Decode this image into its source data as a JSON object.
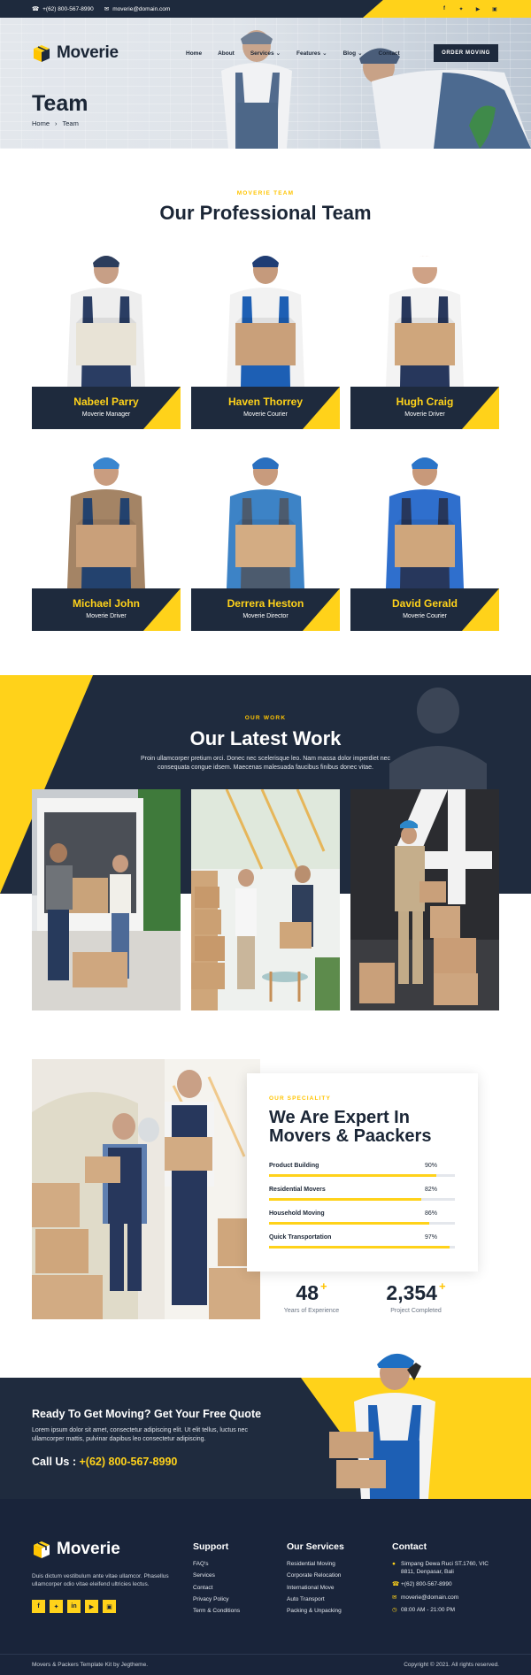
{
  "topbar": {
    "phone": "+(62) 800-567-8990",
    "email": "moverie@domain.com",
    "social": [
      "f",
      "t",
      "yt",
      "ig"
    ]
  },
  "brand": {
    "name": "Moverie"
  },
  "nav": {
    "items": [
      "Home",
      "About",
      "Services",
      "Features",
      "Blog",
      "Contact"
    ],
    "order_button": "ORDER MOVING"
  },
  "hero": {
    "title": "Team",
    "breadcrumb_home": "Home",
    "breadcrumb_current": "Team"
  },
  "team": {
    "eyebrow": "MOVERIE TEAM",
    "title": "Our Professional Team",
    "members": [
      {
        "name": "Nabeel Parry",
        "role": "Moverie Manager"
      },
      {
        "name": "Haven Thorrey",
        "role": "Moverie Courier"
      },
      {
        "name": "Hugh Craig",
        "role": "Moverie Driver"
      },
      {
        "name": "Michael John",
        "role": "Moverie Driver"
      },
      {
        "name": "Derrera Heston",
        "role": "Moverie Director"
      },
      {
        "name": "David Gerald",
        "role": "Moverie Courier"
      }
    ]
  },
  "work": {
    "eyebrow": "OUR WORK",
    "title": "Our Latest Work",
    "text": "Proin ullamcorper pretium orci. Donec nec scelerisque leo. Nam massa dolor imperdiet nec consequata congue idsem. Maecenas malesuada faucibus finibus donec vitae."
  },
  "speciality": {
    "eyebrow": "OUR SPECIALITY",
    "title": "We Are Expert In Movers & Paackers",
    "skills": [
      {
        "label": "Product Building",
        "percent_text": "90%",
        "value": 0.9
      },
      {
        "label": "Residential Movers",
        "percent_text": "82%",
        "value": 0.82
      },
      {
        "label": "Household Moving",
        "percent_text": "86%",
        "value": 0.86
      },
      {
        "label": "Quick Transportation",
        "percent_text": "97%",
        "value": 0.97
      }
    ],
    "stats": [
      {
        "number": "48",
        "plus": "+",
        "caption": "Years of Experience"
      },
      {
        "number": "2,354",
        "plus": "+",
        "caption": "Project Completed"
      }
    ]
  },
  "cta": {
    "title": "Ready To Get Moving? Get Your Free Quote",
    "text": "Lorem ipsum dolor sit amet, consectetur adipiscing elit. Ut elit tellus, luctus nec ullamcorper mattis, pulvinar dapibus leo consectetur adipiscing.",
    "call_label": "Call Us : ",
    "call_phone": "+(62) 800-567-8990"
  },
  "footer": {
    "about": "Duis dictum vestibulum ante vitae ullamcor. Phasellus ullamcorper odio vitae eleifend ultricies lectus.",
    "social": [
      "f",
      "t",
      "in",
      "yt",
      "ig"
    ],
    "support": {
      "title": "Support",
      "items": [
        "FAQ's",
        "Services",
        "Contact",
        "Privacy Policy",
        "Term & Conditions"
      ]
    },
    "services": {
      "title": "Our Services",
      "items": [
        "Residential Moving",
        "Corporate Relocation",
        "International Move",
        "Auto Transport",
        "Packing & Unpacking"
      ]
    },
    "contact": {
      "title": "Contact",
      "address": "Simpang Dewa Ruci ST.1760, VIC 8811, Denpasar, Bali",
      "phone": "+(62) 800-567-8990",
      "email": "moverie@domain.com",
      "hours": "08:00 AM - 21:00 PM"
    },
    "bottom_left": "Movers & Packers Template Kit by Jegtheme.",
    "bottom_right": "Copyright © 2021. All rights reserved."
  },
  "colors": {
    "accent": "#ffd21a",
    "navy": "#1e2a3d",
    "text": "#1b2636"
  }
}
